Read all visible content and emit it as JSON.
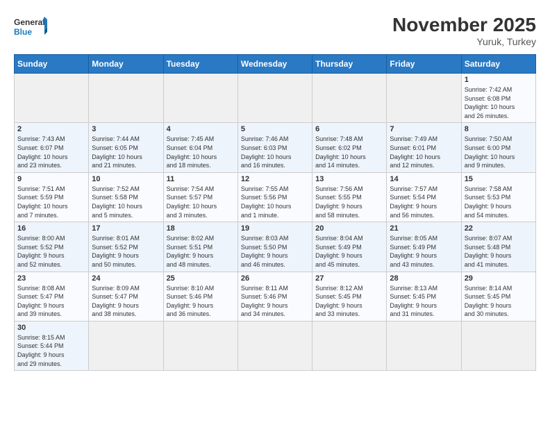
{
  "header": {
    "logo_general": "General",
    "logo_blue": "Blue",
    "month_year": "November 2025",
    "location": "Yuruk, Turkey"
  },
  "weekdays": [
    "Sunday",
    "Monday",
    "Tuesday",
    "Wednesday",
    "Thursday",
    "Friday",
    "Saturday"
  ],
  "weeks": [
    [
      {
        "day": "",
        "info": ""
      },
      {
        "day": "",
        "info": ""
      },
      {
        "day": "",
        "info": ""
      },
      {
        "day": "",
        "info": ""
      },
      {
        "day": "",
        "info": ""
      },
      {
        "day": "",
        "info": ""
      },
      {
        "day": "1",
        "info": "Sunrise: 7:42 AM\nSunset: 6:08 PM\nDaylight: 10 hours\nand 26 minutes."
      }
    ],
    [
      {
        "day": "2",
        "info": "Sunrise: 7:43 AM\nSunset: 6:07 PM\nDaylight: 10 hours\nand 23 minutes."
      },
      {
        "day": "3",
        "info": "Sunrise: 7:44 AM\nSunset: 6:05 PM\nDaylight: 10 hours\nand 21 minutes."
      },
      {
        "day": "4",
        "info": "Sunrise: 7:45 AM\nSunset: 6:04 PM\nDaylight: 10 hours\nand 18 minutes."
      },
      {
        "day": "5",
        "info": "Sunrise: 7:46 AM\nSunset: 6:03 PM\nDaylight: 10 hours\nand 16 minutes."
      },
      {
        "day": "6",
        "info": "Sunrise: 7:48 AM\nSunset: 6:02 PM\nDaylight: 10 hours\nand 14 minutes."
      },
      {
        "day": "7",
        "info": "Sunrise: 7:49 AM\nSunset: 6:01 PM\nDaylight: 10 hours\nand 12 minutes."
      },
      {
        "day": "8",
        "info": "Sunrise: 7:50 AM\nSunset: 6:00 PM\nDaylight: 10 hours\nand 9 minutes."
      }
    ],
    [
      {
        "day": "9",
        "info": "Sunrise: 7:51 AM\nSunset: 5:59 PM\nDaylight: 10 hours\nand 7 minutes."
      },
      {
        "day": "10",
        "info": "Sunrise: 7:52 AM\nSunset: 5:58 PM\nDaylight: 10 hours\nand 5 minutes."
      },
      {
        "day": "11",
        "info": "Sunrise: 7:54 AM\nSunset: 5:57 PM\nDaylight: 10 hours\nand 3 minutes."
      },
      {
        "day": "12",
        "info": "Sunrise: 7:55 AM\nSunset: 5:56 PM\nDaylight: 10 hours\nand 1 minute."
      },
      {
        "day": "13",
        "info": "Sunrise: 7:56 AM\nSunset: 5:55 PM\nDaylight: 9 hours\nand 58 minutes."
      },
      {
        "day": "14",
        "info": "Sunrise: 7:57 AM\nSunset: 5:54 PM\nDaylight: 9 hours\nand 56 minutes."
      },
      {
        "day": "15",
        "info": "Sunrise: 7:58 AM\nSunset: 5:53 PM\nDaylight: 9 hours\nand 54 minutes."
      }
    ],
    [
      {
        "day": "16",
        "info": "Sunrise: 8:00 AM\nSunset: 5:52 PM\nDaylight: 9 hours\nand 52 minutes."
      },
      {
        "day": "17",
        "info": "Sunrise: 8:01 AM\nSunset: 5:52 PM\nDaylight: 9 hours\nand 50 minutes."
      },
      {
        "day": "18",
        "info": "Sunrise: 8:02 AM\nSunset: 5:51 PM\nDaylight: 9 hours\nand 48 minutes."
      },
      {
        "day": "19",
        "info": "Sunrise: 8:03 AM\nSunset: 5:50 PM\nDaylight: 9 hours\nand 46 minutes."
      },
      {
        "day": "20",
        "info": "Sunrise: 8:04 AM\nSunset: 5:49 PM\nDaylight: 9 hours\nand 45 minutes."
      },
      {
        "day": "21",
        "info": "Sunrise: 8:05 AM\nSunset: 5:49 PM\nDaylight: 9 hours\nand 43 minutes."
      },
      {
        "day": "22",
        "info": "Sunrise: 8:07 AM\nSunset: 5:48 PM\nDaylight: 9 hours\nand 41 minutes."
      }
    ],
    [
      {
        "day": "23",
        "info": "Sunrise: 8:08 AM\nSunset: 5:47 PM\nDaylight: 9 hours\nand 39 minutes."
      },
      {
        "day": "24",
        "info": "Sunrise: 8:09 AM\nSunset: 5:47 PM\nDaylight: 9 hours\nand 38 minutes."
      },
      {
        "day": "25",
        "info": "Sunrise: 8:10 AM\nSunset: 5:46 PM\nDaylight: 9 hours\nand 36 minutes."
      },
      {
        "day": "26",
        "info": "Sunrise: 8:11 AM\nSunset: 5:46 PM\nDaylight: 9 hours\nand 34 minutes."
      },
      {
        "day": "27",
        "info": "Sunrise: 8:12 AM\nSunset: 5:45 PM\nDaylight: 9 hours\nand 33 minutes."
      },
      {
        "day": "28",
        "info": "Sunrise: 8:13 AM\nSunset: 5:45 PM\nDaylight: 9 hours\nand 31 minutes."
      },
      {
        "day": "29",
        "info": "Sunrise: 8:14 AM\nSunset: 5:45 PM\nDaylight: 9 hours\nand 30 minutes."
      }
    ],
    [
      {
        "day": "30",
        "info": "Sunrise: 8:15 AM\nSunset: 5:44 PM\nDaylight: 9 hours\nand 29 minutes."
      },
      {
        "day": "",
        "info": ""
      },
      {
        "day": "",
        "info": ""
      },
      {
        "day": "",
        "info": ""
      },
      {
        "day": "",
        "info": ""
      },
      {
        "day": "",
        "info": ""
      },
      {
        "day": "",
        "info": ""
      }
    ]
  ]
}
